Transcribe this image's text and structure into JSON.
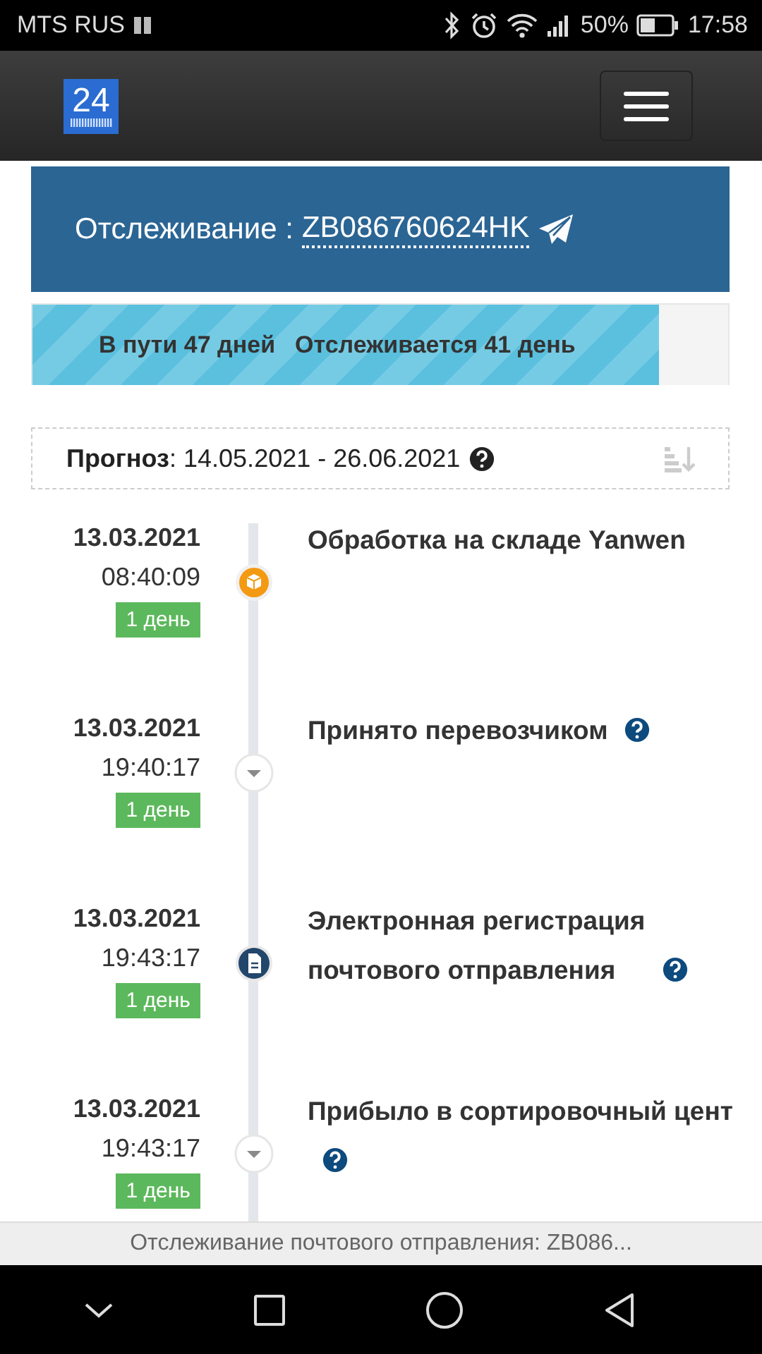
{
  "status_bar": {
    "carrier": "MTS RUS",
    "battery": "50%",
    "time": "17:58"
  },
  "header": {
    "logo": "24"
  },
  "tracking": {
    "label": "Отслеживание :",
    "number": "ZB086760624HK"
  },
  "progress": {
    "level": 0.9,
    "in_transit": "В пути 47 дней",
    "tracked": "Отслеживается 41 день"
  },
  "forecast": {
    "label": "Прогноз",
    "value": ": 14.05.2021 - 26.06.2021"
  },
  "events": [
    {
      "date": "13.03.2021",
      "time": "08:40:09",
      "duration": "1 день",
      "title": "Обработка на складе Yanwen",
      "kind": "box",
      "help": false
    },
    {
      "date": "13.03.2021",
      "time": "19:40:17",
      "duration": "1 день",
      "title": "Принято перевозчиком",
      "kind": "arrow",
      "help": true
    },
    {
      "date": "13.03.2021",
      "time": "19:43:17",
      "duration": "1 день",
      "title": "Электронная регистрация почтового отправления",
      "kind": "document",
      "help": true
    },
    {
      "date": "13.03.2021",
      "time": "19:43:17",
      "duration": "1 день",
      "title": "Прибыло в сортировочный цент",
      "kind": "arrow",
      "help": true
    }
  ],
  "page_title_bar": "Отслеживание почтового отправления: ZB086..."
}
